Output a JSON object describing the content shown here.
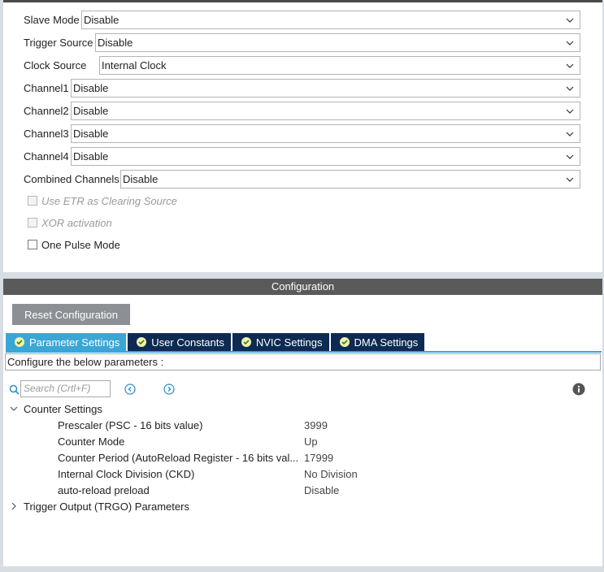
{
  "modes": [
    {
      "label": "Slave Mode",
      "value": "Disable"
    },
    {
      "label": "Trigger Source",
      "value": "Disable"
    },
    {
      "label": "Clock Source",
      "value": "Internal Clock"
    },
    {
      "label": "Channel1",
      "value": "Disable"
    },
    {
      "label": "Channel2",
      "value": "Disable"
    },
    {
      "label": "Channel3",
      "value": "Disable"
    },
    {
      "label": "Channel4",
      "value": "Disable"
    },
    {
      "label": "Combined Channels",
      "value": "Disable"
    }
  ],
  "checkboxes": [
    {
      "label": "Use ETR as Clearing Source",
      "enabled": false,
      "checked": false
    },
    {
      "label": "XOR activation",
      "enabled": false,
      "checked": false
    },
    {
      "label": "One Pulse Mode",
      "enabled": true,
      "checked": false
    }
  ],
  "config": {
    "header": "Configuration",
    "reset_label": "Reset Configuration",
    "tabs": [
      {
        "label": "Parameter Settings",
        "active": true
      },
      {
        "label": "User Constants",
        "active": false
      },
      {
        "label": "NVIC Settings",
        "active": false
      },
      {
        "label": "DMA Settings",
        "active": false
      }
    ],
    "info_text": "Configure the below parameters :",
    "search_placeholder": "Search (Crtl+F)"
  },
  "tree": {
    "counter_settings": {
      "label": "Counter Settings",
      "expanded": true,
      "params": [
        {
          "name": "Prescaler (PSC - 16 bits value)",
          "value": "3999"
        },
        {
          "name": "Counter Mode",
          "value": "Up"
        },
        {
          "name": "Counter Period (AutoReload Register - 16 bits val...",
          "value": "17999"
        },
        {
          "name": "Internal Clock Division (CKD)",
          "value": "No Division"
        },
        {
          "name": "auto-reload preload",
          "value": "Disable"
        }
      ]
    },
    "trgo": {
      "label": "Trigger Output (TRGO) Parameters",
      "expanded": false
    }
  },
  "colors": {
    "tab_active": "#3aa6d6",
    "tab_inactive": "#0e2a52",
    "header_bg": "#5a5a5a",
    "reset_bg": "#8c9094"
  }
}
